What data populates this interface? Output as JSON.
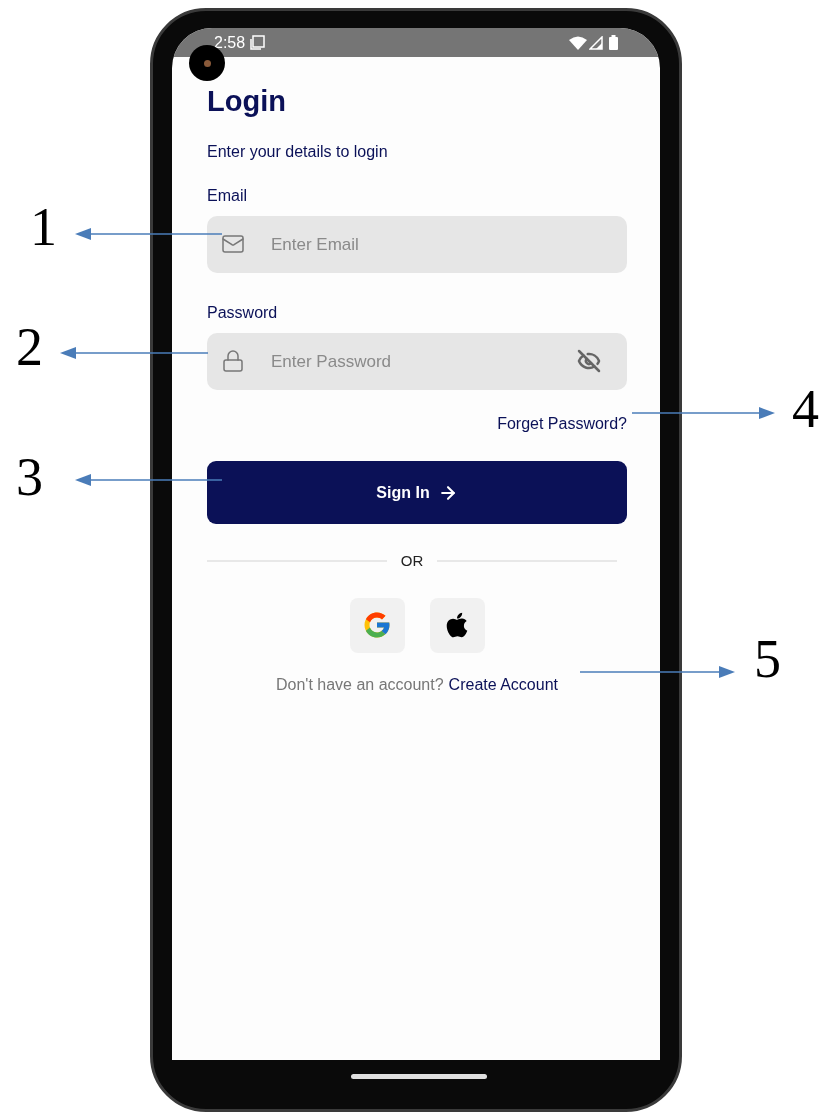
{
  "status_bar": {
    "time": "2:58"
  },
  "title": "Login",
  "subtitle": "Enter your details to login",
  "fields": [
    {
      "label": "Email",
      "placeholder": "Enter Email",
      "kind": "email"
    },
    {
      "label": "Password",
      "placeholder": "Enter Password",
      "kind": "password"
    }
  ],
  "forgot_link": "Forget Password?",
  "sign_in_button": "Sign In",
  "divider": "OR",
  "social_buttons": [
    {
      "kind": "google"
    },
    {
      "kind": "apple"
    }
  ],
  "signup_prompt": {
    "text": "Don't have an account?",
    "link": "Create Account"
  },
  "annotations": [
    {
      "label": "1"
    },
    {
      "label": "2"
    },
    {
      "label": "3"
    },
    {
      "label": "4"
    },
    {
      "label": "5"
    }
  ]
}
